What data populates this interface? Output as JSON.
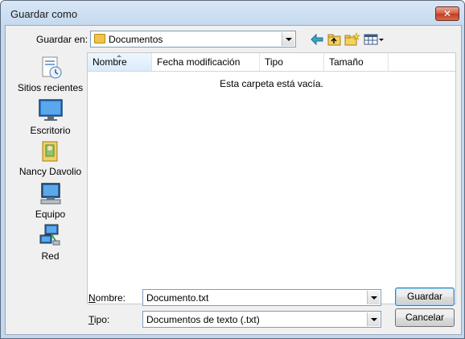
{
  "window": {
    "title": "Guardar como",
    "close_label": "✕"
  },
  "toolbar": {
    "look_in_label": "Guardar en:",
    "look_in_value": "Documentos",
    "icons": [
      "back-arrow-icon",
      "up-folder-icon",
      "new-folder-icon",
      "views-menu-icon"
    ]
  },
  "places": [
    {
      "label": "Sitios recientes",
      "icon": "recent-places-icon"
    },
    {
      "label": "Escritorio",
      "icon": "desktop-icon"
    },
    {
      "label": "Nancy Davolio",
      "icon": "user-folder-icon"
    },
    {
      "label": "Equipo",
      "icon": "computer-icon"
    },
    {
      "label": "Red",
      "icon": "network-icon"
    }
  ],
  "file_list": {
    "columns": [
      "Nombre",
      "Fecha modificación",
      "Tipo",
      "Tamaño"
    ],
    "empty_message": "Esta carpeta está vacía."
  },
  "form": {
    "filename_label": "Nombre:",
    "filename_value": "Documento.txt",
    "type_label": "Tipo:",
    "type_value": "Documentos de texto (.txt)"
  },
  "buttons": {
    "save": "Guardar",
    "cancel": "Cancelar"
  },
  "colors": {
    "title_bar": "#c5d9ef",
    "close_button": "#c03c22",
    "dialog_face": "#f0f0f0"
  }
}
